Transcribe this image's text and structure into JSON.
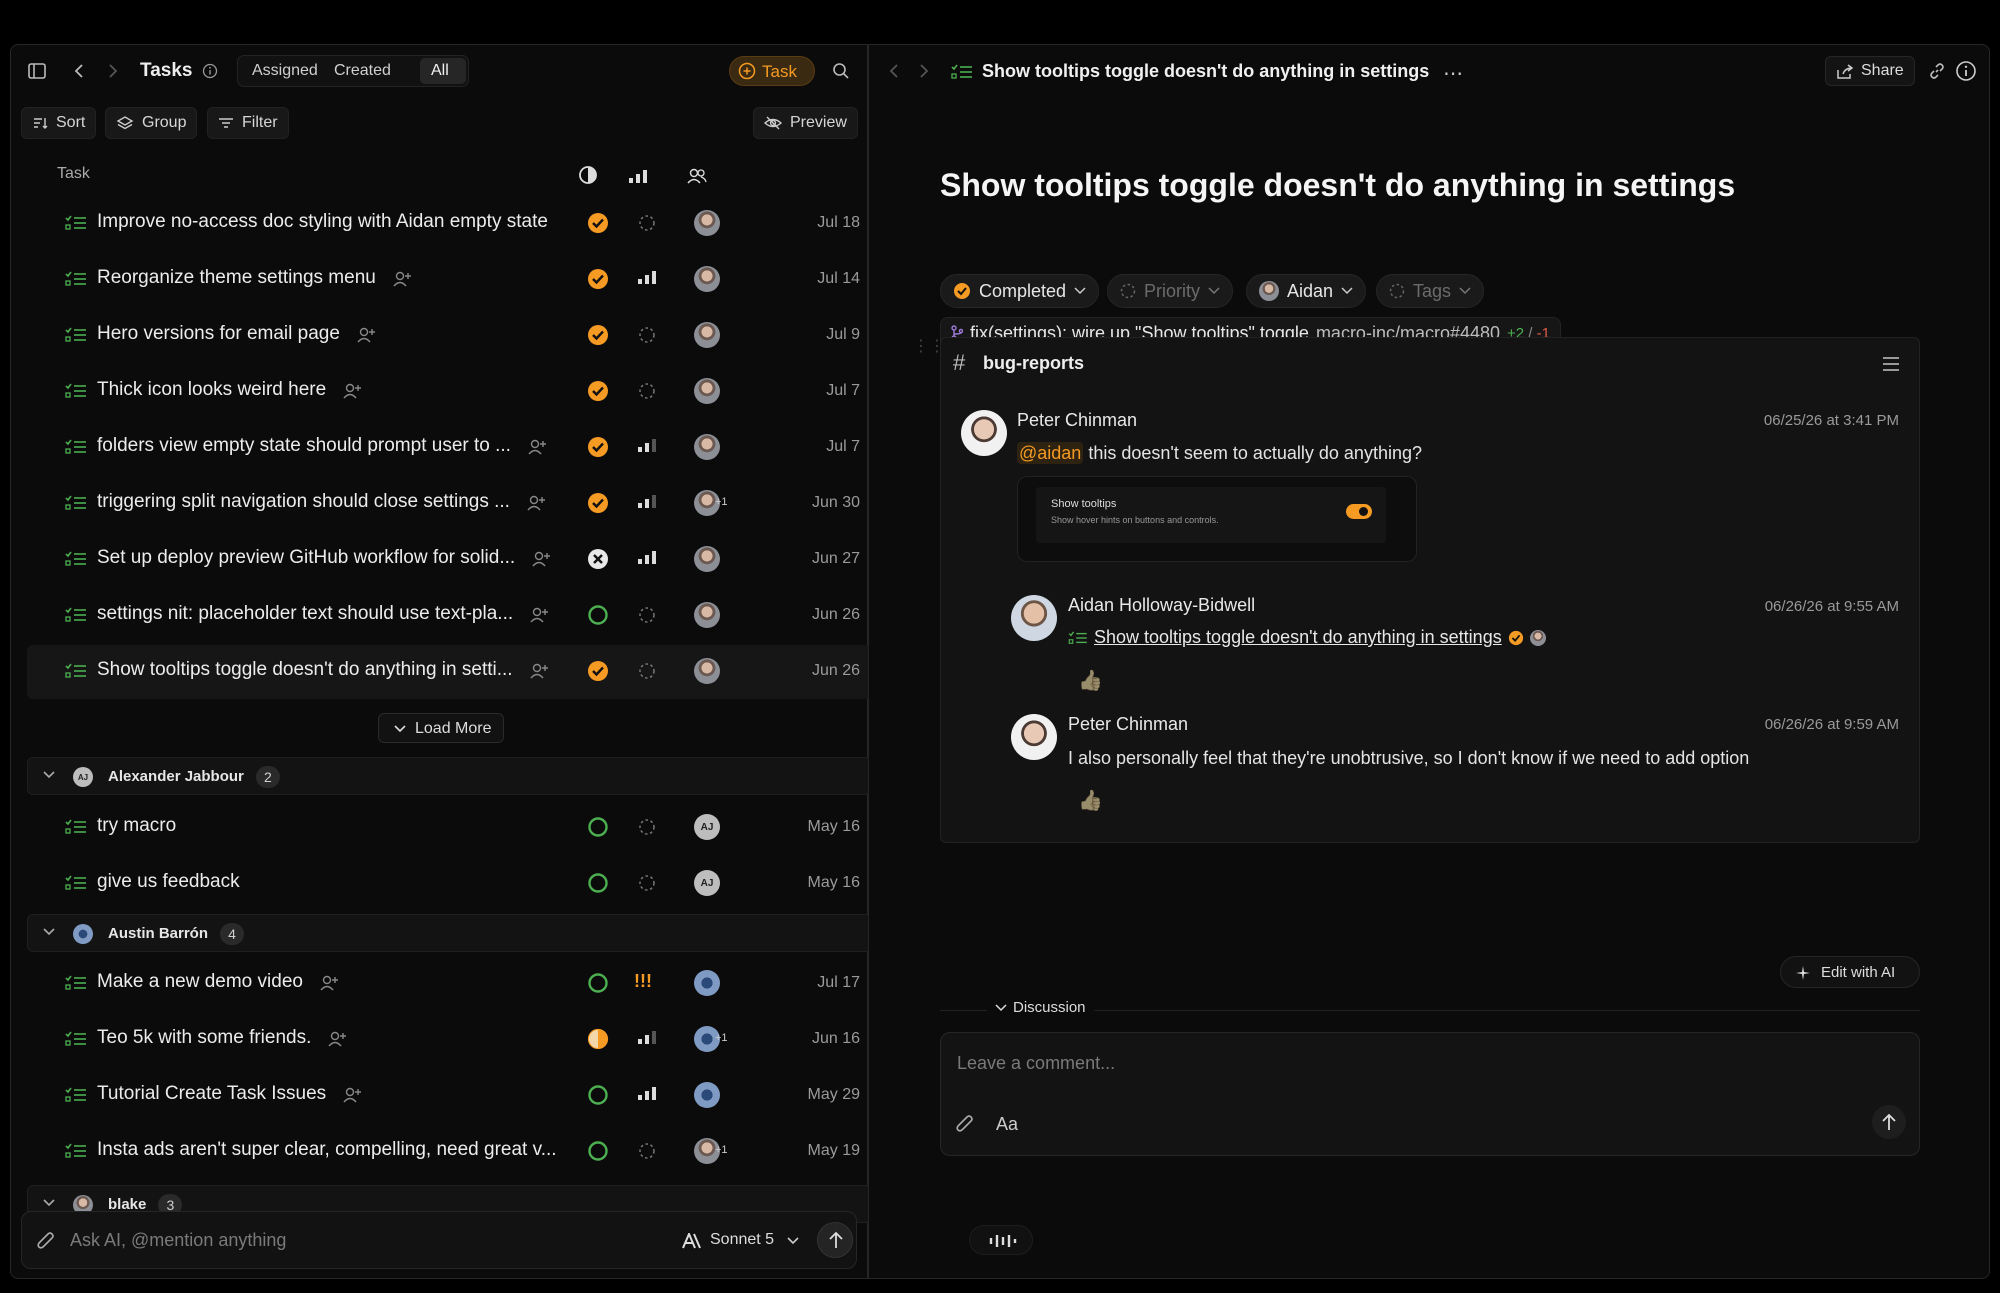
{
  "left": {
    "title": "Tasks",
    "tabs": [
      "Assigned",
      "Created",
      "All"
    ],
    "new_task_label": "Task",
    "sort_label": "Sort",
    "group_label": "Group",
    "filter_label": "Filter",
    "preview_label": "Preview",
    "column_task": "Task",
    "load_more_label": "Load More",
    "rows_top": [
      {
        "title": "Improve no-access doc styling with Aidan empty state",
        "status": "completed",
        "priority": "none",
        "avatar": "photo",
        "date": "Jul 18",
        "assign_icon": false
      },
      {
        "title": "Reorganize theme settings menu",
        "status": "completed",
        "priority": "high",
        "avatar": "photo",
        "date": "Jul 14",
        "assign_icon": true
      },
      {
        "title": "Hero versions for email page",
        "status": "completed",
        "priority": "none",
        "avatar": "photo",
        "date": "Jul 9",
        "assign_icon": true
      },
      {
        "title": "Thick icon looks weird here",
        "status": "completed",
        "priority": "none",
        "avatar": "photo",
        "date": "Jul 7",
        "assign_icon": true
      },
      {
        "title": "folders view empty state should prompt user to ...",
        "status": "completed",
        "priority": "medium",
        "avatar": "photo",
        "date": "Jul 7",
        "assign_icon": true
      },
      {
        "title": "triggering split navigation should close settings ...",
        "status": "completed",
        "priority": "medium",
        "avatar": "photo+1",
        "date": "Jun 30",
        "assign_icon": true
      },
      {
        "title": "Set up deploy preview GitHub workflow for solid...",
        "status": "cancelled",
        "priority": "high",
        "avatar": "photo",
        "date": "Jun 27",
        "assign_icon": true
      },
      {
        "title": "settings nit: placeholder text should use text-pla...",
        "status": "todo",
        "priority": "none",
        "avatar": "photo",
        "date": "Jun 26",
        "assign_icon": true
      },
      {
        "title": "Show tooltips toggle doesn't do anything in setti...",
        "status": "completed",
        "priority": "none",
        "avatar": "photo",
        "date": "Jun 26",
        "assign_icon": true,
        "selected": true
      }
    ],
    "groups": [
      {
        "name": "Alexander Jabbour",
        "count": "2",
        "avatar": "AJ"
      },
      {
        "name": "Austin Barrón",
        "count": "4",
        "avatar": "ab"
      },
      {
        "name": "blake",
        "count": "3",
        "avatar": "photo"
      }
    ],
    "rows_aj": [
      {
        "title": "try macro",
        "status": "todo",
        "priority": "none",
        "avatar": "AJ",
        "date": "May 16",
        "assign_icon": false
      },
      {
        "title": "give us feedback",
        "status": "todo",
        "priority": "none",
        "avatar": "AJ",
        "date": "May 16",
        "assign_icon": false
      }
    ],
    "rows_ab": [
      {
        "title": "Make a new demo video",
        "status": "todo",
        "priority": "urgent",
        "avatar": "ab",
        "date": "Jul 17",
        "assign_icon": true
      },
      {
        "title": "Teo 5k with some friends.",
        "status": "inprogress",
        "priority": "medium",
        "avatar": "ab+1",
        "date": "Jun 16",
        "assign_icon": true
      },
      {
        "title": "Tutorial Create Task Issues",
        "status": "todo",
        "priority": "high",
        "avatar": "ab",
        "date": "May 29",
        "assign_icon": true
      },
      {
        "title": "Insta ads aren't super clear, compelling, need great v...",
        "status": "todo",
        "priority": "none",
        "avatar": "photo+1",
        "date": "May 19",
        "assign_icon": false
      }
    ],
    "ai_placeholder": "Ask AI, @mention anything",
    "model_label": "Sonnet 5",
    "plus_one": "+1",
    "urgent_glyph": "!!!"
  },
  "right": {
    "breadcrumb_title": "Show tooltips toggle doesn't do anything in settings",
    "share_label": "Share",
    "heading": "Show tooltips toggle doesn't do anything in settings",
    "status_chip": "Completed",
    "priority_chip": "Priority",
    "assignee_chip": "Aidan",
    "tags_chip": "Tags",
    "pr_title": "fix(settings): wire up \"Show tooltips\" toggle",
    "pr_ref": "macro-inc/macro#4480",
    "pr_add": "+2",
    "pr_sep": "/",
    "pr_del": "-1",
    "channel": "bug-reports",
    "messages": [
      {
        "author": "Peter Chinman",
        "time": "06/25/26 at 3:41 PM",
        "mention": "@aidan",
        "text": "this doesn't seem to actually do anything?"
      },
      {
        "author": "Aidan Holloway-Bidwell",
        "time": "06/26/26 at 9:55 AM",
        "link_text": "Show tooltips toggle doesn't do anything in settings"
      },
      {
        "author": "Peter Chinman",
        "time": "06/26/26 at 9:59 AM",
        "text": "I also personally feel that they're unobtrusive, so I don't know if we need to add option"
      }
    ],
    "embed": {
      "title": "Show tooltips",
      "subtitle": "Show hover hints on buttons and controls."
    },
    "edit_ai_label": "Edit with AI",
    "discussion_label": "Discussion",
    "comment_placeholder": "Leave a comment...",
    "format_label": "Aa"
  },
  "colors": {
    "accent": "#f59a23",
    "todo": "#4caf50",
    "bg": "#0b0b0b"
  }
}
